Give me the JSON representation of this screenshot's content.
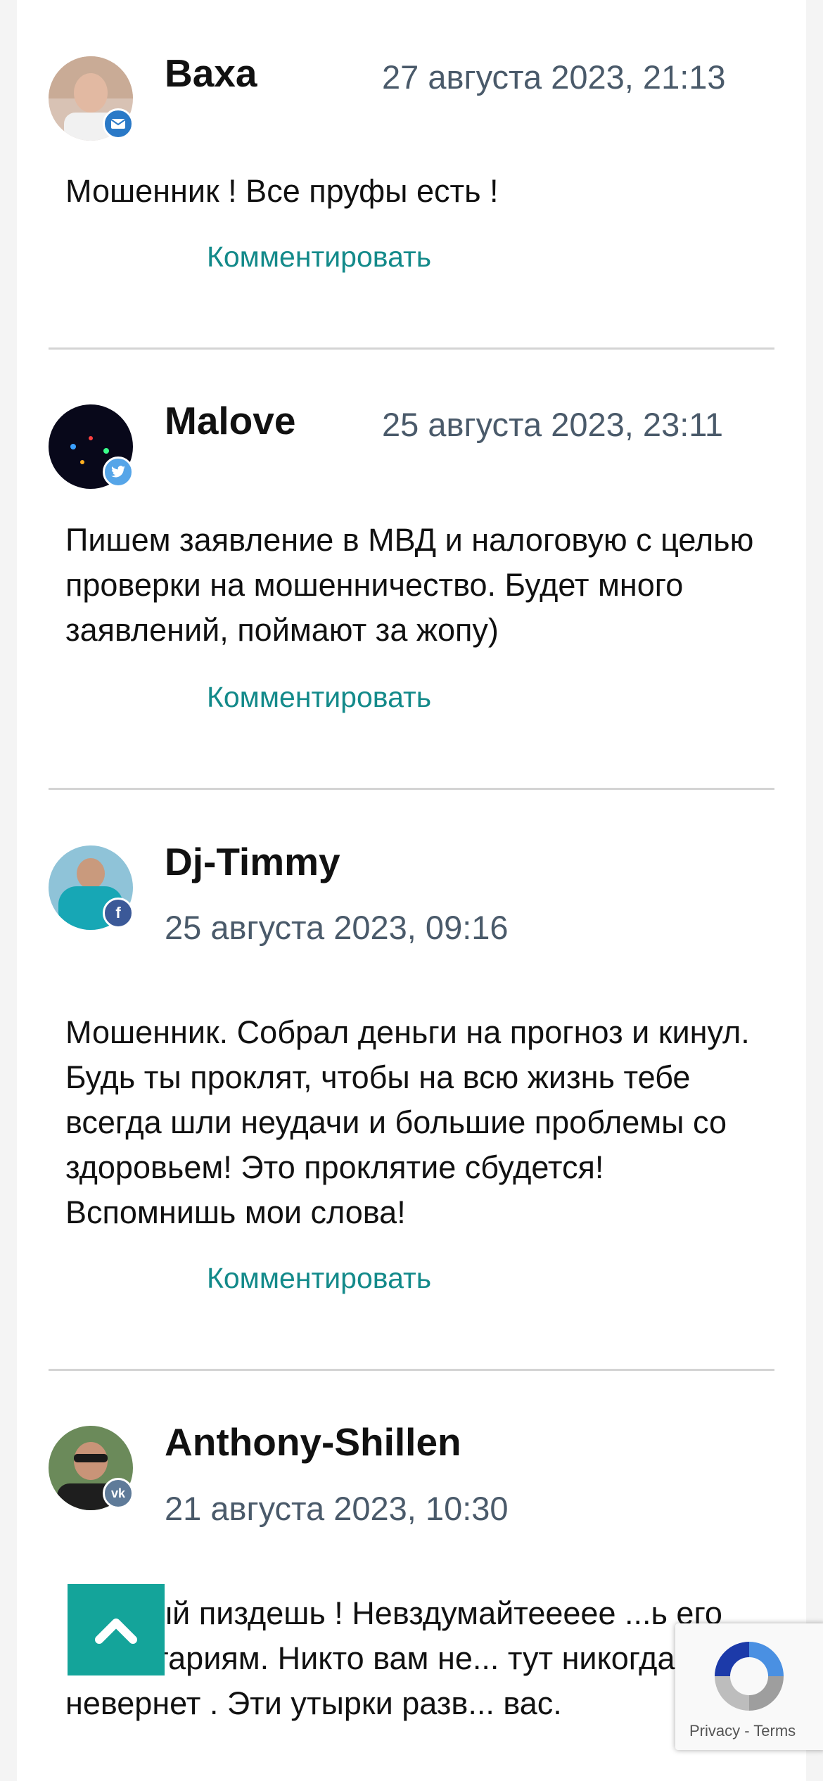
{
  "comments": [
    {
      "author": "Ваха",
      "date": "27 августа 2023, 21:13",
      "badge": "mail-icon",
      "badge_color": "#2a79c7",
      "text": "Мошенник ! Все пруфы есть !",
      "reply_label": "Комментировать"
    },
    {
      "author": "Malove",
      "date": "25 августа 2023, 23:11",
      "badge": "twitter-icon",
      "badge_color": "#56a5e8",
      "text": "Пишем заявление в МВД и налоговую с целью проверки на мошенничество. Будет много заявлений, поймают за жопу)",
      "reply_label": "Комментировать"
    },
    {
      "author": "Dj-Timmy",
      "date": "25 августа 2023, 09:16",
      "badge": "facebook-icon",
      "badge_color": "#3b5998",
      "text": "Мошенник. Собрал деньги на прогноз и кинул. Будь ты проклят, чтобы на всю жизнь тебе всегда шли неудачи и большие проблемы со здоровьем! Это проклятие сбудется! Вспомнишь мои слова!",
      "reply_label": "Комментировать"
    },
    {
      "author": "Anthony-Shillen",
      "date": "21 августа 2023, 10:30",
      "badge": "vk-icon",
      "badge_color": "#5f7b99",
      "text": "...лимый пиздешь ! Невздумайтеееее ...ь его коментариям. Никто вам не... тут никогда невернет . Эти утырки разв... вас."
    }
  ],
  "scroll_top": {
    "icon": "chevron-up-icon",
    "color": "#14a49a"
  },
  "recaptcha": {
    "privacy": "Privacy",
    "separator": "-",
    "terms": "Terms"
  },
  "colors": {
    "link": "#138a8a",
    "date": "#4a5a6a",
    "divider": "#d4d4d4"
  }
}
